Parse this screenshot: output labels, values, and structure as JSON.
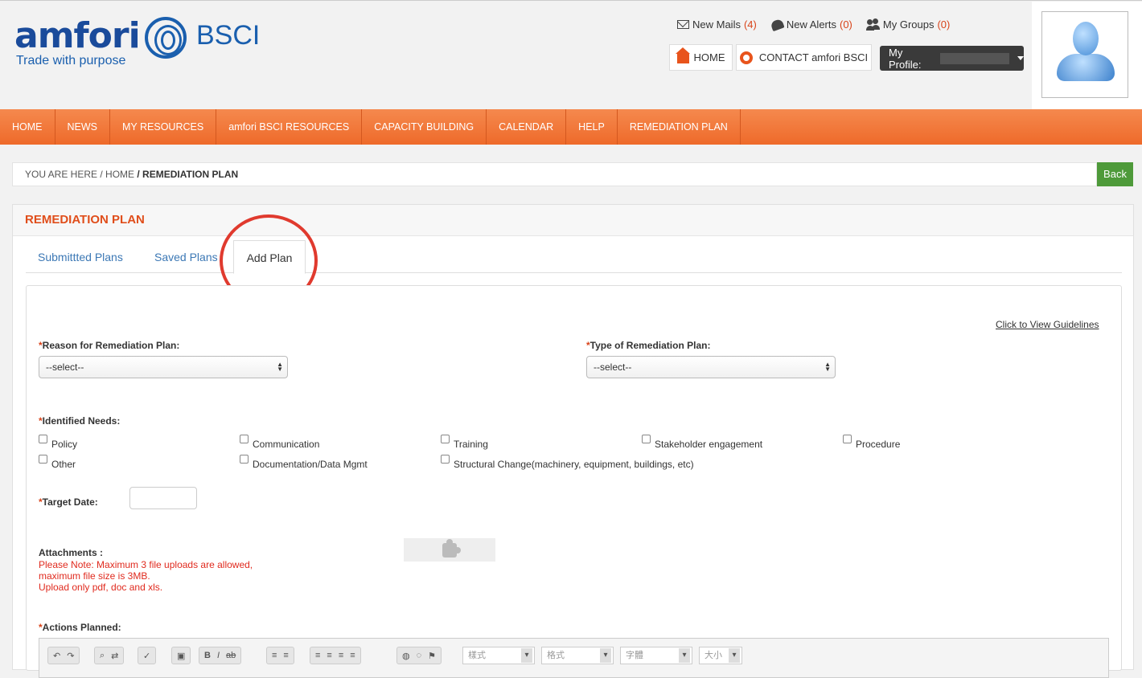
{
  "brand": {
    "word": "amfori",
    "sub": "BSCI",
    "tagline": "Trade with purpose"
  },
  "toplinks": {
    "mails_label": "New Mails",
    "mails_count": "(4)",
    "alerts_label": "New Alerts",
    "alerts_count": "(0)",
    "groups_label": "My Groups",
    "groups_count": "(0)"
  },
  "header_buttons": {
    "home": "HOME",
    "contact": "CONTACT amfori BSCI",
    "profile": "My Profile:"
  },
  "nav": [
    "HOME",
    "NEWS",
    "MY RESOURCES",
    "amfori BSCI RESOURCES",
    "CAPACITY BUILDING",
    "CALENDAR",
    "HELP",
    "REMEDIATION PLAN"
  ],
  "breadcrumb": {
    "prefix": "YOU ARE HERE / HOME",
    "current": "/ REMEDIATION PLAN",
    "back": "Back"
  },
  "panel": {
    "title": "REMEDIATION PLAN"
  },
  "tabs": {
    "submitted": "Submittted Plans",
    "saved": "Saved Plans",
    "add": "Add Plan"
  },
  "form": {
    "guidelines": "Click to View Guidelines",
    "required_mark": "*",
    "reason_label": "Reason for Remediation Plan:",
    "reason_value": "--select--",
    "type_label": "Type of Remediation Plan:",
    "type_value": "--select--",
    "needs_label": "Identified Needs:",
    "needs": [
      "Policy",
      "Communication",
      "Training",
      "Stakeholder engagement",
      "Procedure",
      "Other",
      "Documentation/Data Mgmt",
      "Structural Change(machinery, equipment, buildings, etc)"
    ],
    "target_label": "Target Date:",
    "attachments_label": "Attachments :",
    "note_lines": [
      "Please Note: Maximum 3 file uploads are allowed,",
      "maximum file size is 3MB.",
      "Upload only pdf, doc and xls."
    ],
    "actions_label": "Actions Planned:"
  },
  "editor": {
    "styles": "樣式",
    "format": "格式",
    "font": "字體",
    "size": "大小"
  }
}
